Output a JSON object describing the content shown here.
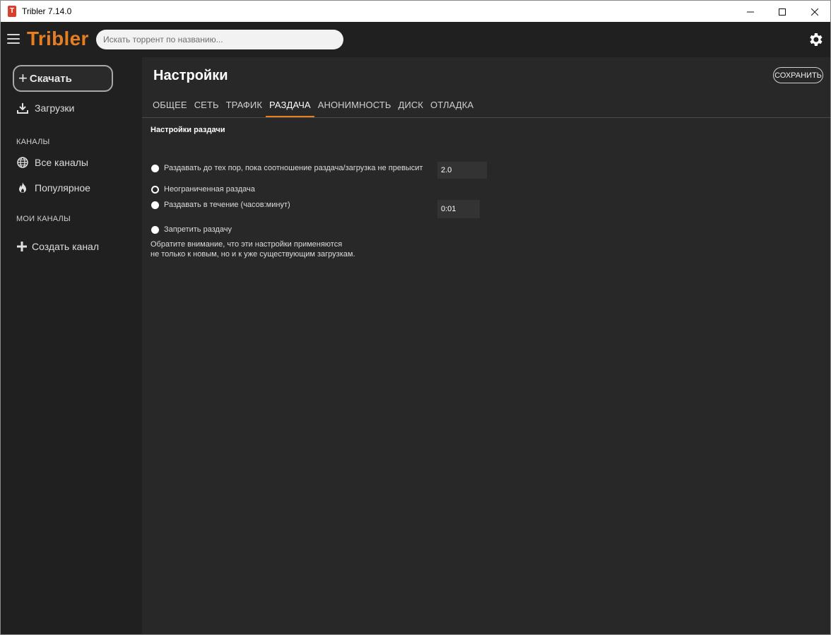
{
  "window": {
    "title": "Tribler 7.14.0",
    "app_icon_glyph": "T"
  },
  "header": {
    "brand": "Tribler",
    "search_placeholder": "Искать торрент по названию...",
    "brand_color": "#e67e22"
  },
  "sidebar": {
    "download_button": "Скачать",
    "downloads": "Загрузки",
    "channels_heading": "КАНАЛЫ",
    "all_channels": "Все каналы",
    "popular": "Популярное",
    "my_channels_heading": "МОИ КАНАЛЫ",
    "create_channel": "Создать канал"
  },
  "settings": {
    "title": "Настройки",
    "save_label": "СОХРАНИТЬ",
    "tabs": [
      {
        "label": "ОБЩЕЕ",
        "active": false
      },
      {
        "label": "СЕТЬ",
        "active": false
      },
      {
        "label": "ТРАФИК",
        "active": false
      },
      {
        "label": "РАЗДАЧА",
        "active": true
      },
      {
        "label": "АНОНИМНОСТЬ",
        "active": false
      },
      {
        "label": "ДИСК",
        "active": false
      },
      {
        "label": "ОТЛАДКА",
        "active": false
      }
    ],
    "seeding": {
      "section_title": "Настройки раздачи",
      "option_ratio": "Раздавать до тех пор, пока соотношение раздача/загрузка не превысит",
      "ratio_value": "2.0",
      "option_unlimited": "Неограниченная раздача",
      "option_time": "Раздавать в течение (часов:минут)",
      "time_value": "0:01",
      "option_disable": "Запретить раздачу",
      "selected": "unlimited",
      "note_line1": "Обратите внимание, что эти настройки применяются",
      "note_line2": "не только к новым, но и к уже существующим загрузкам."
    }
  }
}
